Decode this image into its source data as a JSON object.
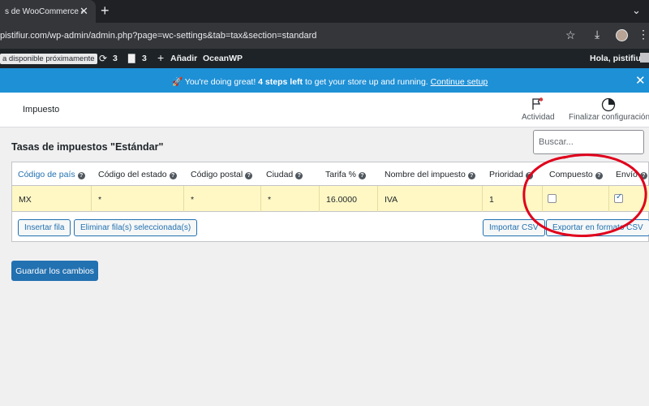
{
  "browser": {
    "tab_title": "s de WooCommerce ‹",
    "url": "pistifiur.com/wp-admin/admin.php?page=wc-settings&tab=tax&section=standard",
    "icons": [
      "close-icon",
      "plus-icon",
      "chevron-down-icon",
      "star-icon",
      "download-icon",
      "avatar",
      "kebab-icon"
    ]
  },
  "adminbar": {
    "availability": "a disponible próximamente",
    "updates_count": "3",
    "comments_count": "3",
    "new_label": "Añadir",
    "theme_label": "OceanWP",
    "greeting": "Hola, pistifiur"
  },
  "banner": {
    "emoji": "🚀",
    "text_before": " You're doing great! ",
    "text_bold": "4 steps left",
    "text_after": " to get your store up and running. ",
    "link": "Continue setup"
  },
  "header": {
    "title": "Impuesto",
    "activity_label": "Actividad",
    "finish_label": "Finalizar configuración"
  },
  "page": {
    "title": "Tasas de impuestos \"Estándar\"",
    "search_placeholder": "Buscar..."
  },
  "table": {
    "columns": [
      "Código de país",
      "Código del estado",
      "Código postal",
      "Ciudad",
      "Tarifa %",
      "Nombre del impuesto",
      "Prioridad",
      "Compuesto",
      "Envío"
    ],
    "row": {
      "country": "MX",
      "state": "*",
      "postcode": "*",
      "city": "*",
      "rate": "16.0000",
      "name": "IVA",
      "priority": "1",
      "compound": false,
      "shipping": true
    }
  },
  "buttons": {
    "insert_row": "Insertar fila",
    "delete_rows": "Eliminar fila(s) seleccionada(s)",
    "import_csv": "Importar CSV",
    "export_csv": "Exportar en formato CSV",
    "save": "Guardar los cambios"
  },
  "colors": {
    "banner": "#1e90d6",
    "row_highlight": "#fff8c5",
    "primary": "#2271b1",
    "annotation": "#e0001b"
  }
}
